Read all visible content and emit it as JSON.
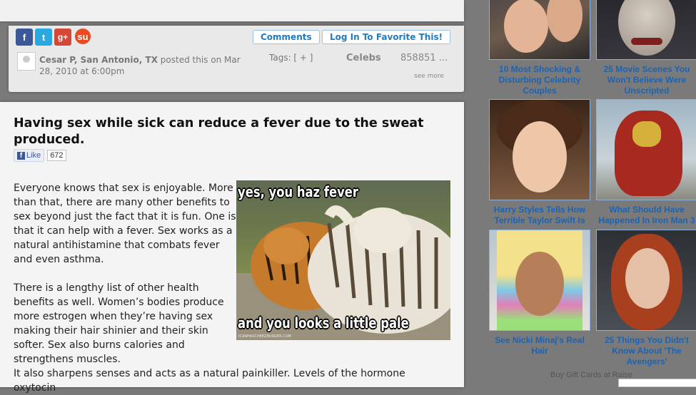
{
  "top_card": {},
  "meta": {
    "social": {
      "facebook": "f",
      "twitter": "t",
      "googleplus": "g+",
      "stumbleupon": "su"
    },
    "comments_label": "Comments",
    "favorite_label": "Log In To Favorite This!",
    "poster_name": "Cesar P, San Antonio, TX",
    "posted_text": " posted this on Mar 28, 2010 at 6:00pm",
    "tags_label": "Tags: [ + ]",
    "category": "Celebs",
    "count": "858851 ...",
    "see_more": "see more"
  },
  "article": {
    "title": "Having sex while sick can reduce a fever due to the sweat produced.",
    "like_label": "Like",
    "like_count": "672",
    "p1": "Everyone knows that sex is enjoyable. More than that, there are many other benefits to sex beyond just the fact that it is fun. One is that it can help with a fever. Sex works as a natural antihistamine that combats fever and even asthma.",
    "p2": "There is a lengthy list of other health benefits as well. Women’s bodies produce more estrogen when they’re having sex making their hair shinier and their skin softer. Sex also burns calories and strengthens muscles.",
    "p3": "It also sharpens senses and acts as a natural painkiller. Levels of the hormone oxytocin",
    "meme_top": "yes, you haz fever",
    "meme_bottom": "and you looks a little pale",
    "meme_watermark": "ICANHASCHEEZBURGER.COM"
  },
  "sidebar": {
    "tiles": [
      {
        "caption": "10 Most Shocking & Disturbing Celebrity Couples"
      },
      {
        "caption": "25 Movie Scenes You Won't Believe Were Unscripted"
      },
      {
        "caption": "Harry Styles Tells How Terrible Taylor Swift Is"
      },
      {
        "caption": "What Should Have Happened In Iron Man 3"
      },
      {
        "caption": "See Nicki Minaj's Real Hair"
      },
      {
        "caption": "25 Things You Didn't Know About 'The Avengers'"
      }
    ],
    "gift_cards": "Buy Gift Cards at Raise"
  },
  "colors": {
    "link": "#1f7bc2",
    "sidebar_caption": "#1b63b5",
    "page_bg": "#7a7a7a"
  }
}
